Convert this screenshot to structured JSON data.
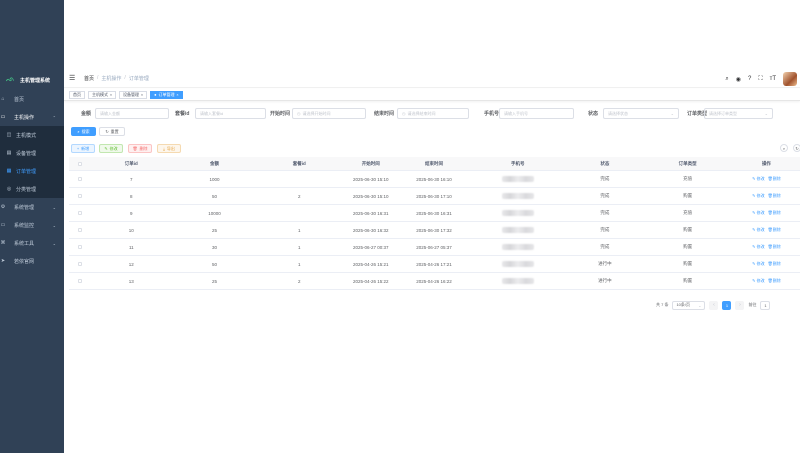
{
  "sidebar": {
    "title": "主机管理系统",
    "items": [
      {
        "label": "首页",
        "icon": "home-icon"
      },
      {
        "label": "主机操作",
        "icon": "monitor-icon"
      },
      {
        "label": "主机模式",
        "icon": "mode-icon"
      },
      {
        "label": "设备管理",
        "icon": "device-icon"
      },
      {
        "label": "订单管理",
        "icon": "order-icon"
      },
      {
        "label": "分类管理",
        "icon": "category-icon"
      },
      {
        "label": "系统管理",
        "icon": "gear-icon"
      },
      {
        "label": "系统监控",
        "icon": "monitor-icon"
      },
      {
        "label": "系统工具",
        "icon": "tool-icon"
      },
      {
        "label": "若依官网",
        "icon": "send-icon"
      }
    ]
  },
  "breadcrumb": [
    "首页",
    "主机操作",
    "订单管理"
  ],
  "tags": [
    {
      "label": "首页",
      "active": false
    },
    {
      "label": "主机模式",
      "active": false
    },
    {
      "label": "设备管理",
      "active": false
    },
    {
      "label": "订单管理",
      "active": true
    }
  ],
  "search": {
    "fields": [
      {
        "label": "金额",
        "placeholder": "请输入金额"
      },
      {
        "label": "套餐id",
        "placeholder": "请输入套餐id"
      },
      {
        "label": "开始时间",
        "placeholder": "请选择开始时间"
      },
      {
        "label": "结束时间",
        "placeholder": "请选择结束时间"
      },
      {
        "label": "手机号",
        "placeholder": "请输入手机号"
      },
      {
        "label": "状态",
        "placeholder": "请选择状态"
      },
      {
        "label": "订单类型",
        "placeholder": "请选择订单类型"
      }
    ],
    "search_btn": "搜索",
    "reset_btn": "重置"
  },
  "toolbar": {
    "add": "新增",
    "edit": "修改",
    "delete": "删除",
    "export": "导出"
  },
  "table": {
    "columns": [
      "订单id",
      "金额",
      "套餐id",
      "开始时间",
      "结束时间",
      "手机号",
      "状态",
      "订单类型",
      "操作"
    ],
    "rows": [
      {
        "id": "7",
        "amount": "1000",
        "plan": "",
        "start": "2025-06-30 15:10",
        "end": "2025-06-30 16:10",
        "status": "完成",
        "type": "充值"
      },
      {
        "id": "8",
        "amount": "50",
        "plan": "2",
        "start": "2025-06-30 15:10",
        "end": "2025-06-30 17:10",
        "status": "完成",
        "type": "购置"
      },
      {
        "id": "9",
        "amount": "10000",
        "plan": "",
        "start": "2025-06-30 16:31",
        "end": "2025-06-30 16:31",
        "status": "完成",
        "type": "充值"
      },
      {
        "id": "10",
        "amount": "25",
        "plan": "1",
        "start": "2025-06-30 16:32",
        "end": "2025-06-30 17:32",
        "status": "完成",
        "type": "购置"
      },
      {
        "id": "11",
        "amount": "30",
        "plan": "1",
        "start": "2025-06-27 00:37",
        "end": "2025-06-27 05:37",
        "status": "完成",
        "type": "购置"
      },
      {
        "id": "12",
        "amount": "50",
        "plan": "1",
        "start": "2025-04-26 15:21",
        "end": "2025-04-26 17:21",
        "status": "进行中",
        "type": "购置"
      },
      {
        "id": "13",
        "amount": "25",
        "plan": "2",
        "start": "2025-04-26 15:22",
        "end": "2025-04-26 16:22",
        "status": "进行中",
        "type": "购置"
      }
    ],
    "edit_label": "修改",
    "delete_label": "删除"
  },
  "pagination": {
    "total_text": "共 7 条",
    "page_size": "10条/页",
    "current_page": "1",
    "goto_label": "前往",
    "goto_value": "1"
  },
  "colors": {
    "sidebar_bg": "#304156",
    "primary": "#409eff"
  }
}
